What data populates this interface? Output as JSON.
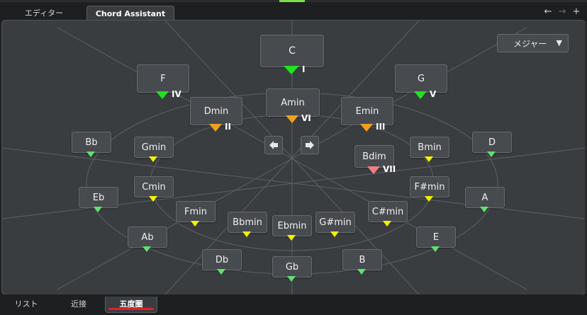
{
  "tabs": [
    {
      "label": "エディター",
      "active": false
    },
    {
      "label": "Chord Assistant",
      "active": true
    }
  ],
  "nav": {
    "back": "←",
    "forward": "→",
    "add": "+"
  },
  "mode_dropdown": {
    "selected": "メジャー",
    "arrow": "▼"
  },
  "prev_arrow": "◀",
  "next_arrow": "▶",
  "colors": {
    "tonic": "#22e022",
    "secondary": "#f0a020",
    "diminished": "#f08080",
    "outer": "#60e070",
    "inner": "#f2f200"
  },
  "chords": [
    {
      "name": "C",
      "roman": "I",
      "marker": "tonic"
    },
    {
      "name": "F",
      "roman": "IV",
      "marker": "tonic"
    },
    {
      "name": "G",
      "roman": "V",
      "marker": "tonic"
    },
    {
      "name": "Amin",
      "roman": "VI",
      "marker": "secondary"
    },
    {
      "name": "Dmin",
      "roman": "II",
      "marker": "secondary"
    },
    {
      "name": "Emin",
      "roman": "III",
      "marker": "secondary"
    },
    {
      "name": "Bdim",
      "roman": "VII",
      "marker": "diminished"
    },
    {
      "name": "Bb",
      "roman": "",
      "marker": "outer"
    },
    {
      "name": "D",
      "roman": "",
      "marker": "outer"
    },
    {
      "name": "Eb",
      "roman": "",
      "marker": "outer"
    },
    {
      "name": "A",
      "roman": "",
      "marker": "outer"
    },
    {
      "name": "Ab",
      "roman": "",
      "marker": "outer"
    },
    {
      "name": "E",
      "roman": "",
      "marker": "outer"
    },
    {
      "name": "Db",
      "roman": "",
      "marker": "outer"
    },
    {
      "name": "Gb",
      "roman": "",
      "marker": "outer"
    },
    {
      "name": "B",
      "roman": "",
      "marker": "outer"
    },
    {
      "name": "Gmin",
      "roman": "",
      "marker": "inner"
    },
    {
      "name": "Bmin",
      "roman": "",
      "marker": "inner"
    },
    {
      "name": "Cmin",
      "roman": "",
      "marker": "inner"
    },
    {
      "name": "F#min",
      "roman": "",
      "marker": "inner"
    },
    {
      "name": "Fmin",
      "roman": "",
      "marker": "inner"
    },
    {
      "name": "C#min",
      "roman": "",
      "marker": "inner"
    },
    {
      "name": "Bbmin",
      "roman": "",
      "marker": "inner"
    },
    {
      "name": "Ebmin",
      "roman": "",
      "marker": "inner"
    },
    {
      "name": "G#min",
      "roman": "",
      "marker": "inner"
    }
  ],
  "bottom_tabs": [
    {
      "label": "リスト",
      "active": false
    },
    {
      "label": "近接",
      "active": false
    },
    {
      "label": "五度圏",
      "active": true
    }
  ]
}
